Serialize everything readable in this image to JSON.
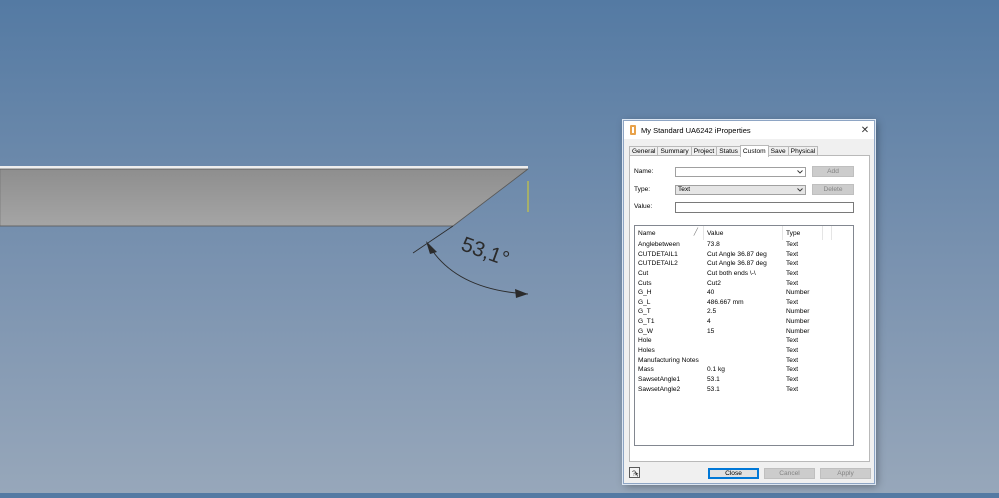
{
  "colors": {
    "background_top": "#547aa3",
    "background_bottom": "#97a7ba",
    "accent": "#0078d7",
    "angle_arrow": "#2b2b2b",
    "edge_highlight": "#d9d22a"
  },
  "viewport": {
    "angle_dimension": "53,1°"
  },
  "dialog": {
    "title": "My Standard UA6242 iProperties",
    "app_icon": "inventor-iproperties-icon",
    "close_glyph": "✕",
    "tabs": [
      {
        "label": "General",
        "active": false
      },
      {
        "label": "Summary",
        "active": false
      },
      {
        "label": "Project",
        "active": false
      },
      {
        "label": "Status",
        "active": false
      },
      {
        "label": "Custom",
        "active": true
      },
      {
        "label": "Save",
        "active": false
      },
      {
        "label": "Physical",
        "active": false
      }
    ],
    "form": {
      "name_label": "Name:",
      "name_value": "",
      "type_label": "Type:",
      "type_value": "Text",
      "value_label": "Value:",
      "value_value": "",
      "add_label": "Add",
      "delete_label": "Delete"
    },
    "list": {
      "columns": {
        "name": "Name",
        "value": "Value",
        "type": "Type"
      },
      "rows": [
        {
          "name": "Anglebetween",
          "value": "73.8",
          "type": "Text"
        },
        {
          "name": "CUTDETAIL1",
          "value": "Cut Angle 36.87 deg",
          "type": "Text"
        },
        {
          "name": "CUTDETAIL2",
          "value": "Cut Angle 36.87 deg",
          "type": "Text"
        },
        {
          "name": "Cut",
          "value": "Cut both ends \\-\\",
          "type": "Text"
        },
        {
          "name": "Cuts",
          "value": "Cut2",
          "type": "Text"
        },
        {
          "name": "G_H",
          "value": "40",
          "type": "Number"
        },
        {
          "name": "G_L",
          "value": "486.667 mm",
          "type": "Text"
        },
        {
          "name": "G_T",
          "value": "2.5",
          "type": "Number"
        },
        {
          "name": "G_T1",
          "value": "4",
          "type": "Number"
        },
        {
          "name": "G_W",
          "value": "15",
          "type": "Number"
        },
        {
          "name": "Hole",
          "value": "",
          "type": "Text"
        },
        {
          "name": "Holes",
          "value": "",
          "type": "Text"
        },
        {
          "name": "Manufacturing Notes",
          "value": "",
          "type": "Text"
        },
        {
          "name": "Mass",
          "value": "0.1 kg",
          "type": "Text"
        },
        {
          "name": "SawsetAngle1",
          "value": "53.1",
          "type": "Text"
        },
        {
          "name": "SawsetAngle2",
          "value": "53.1",
          "type": "Text"
        }
      ]
    },
    "buttons": {
      "close": "Close",
      "cancel": "Cancel",
      "apply": "Apply",
      "help_icon": "help-pointer-icon"
    }
  }
}
